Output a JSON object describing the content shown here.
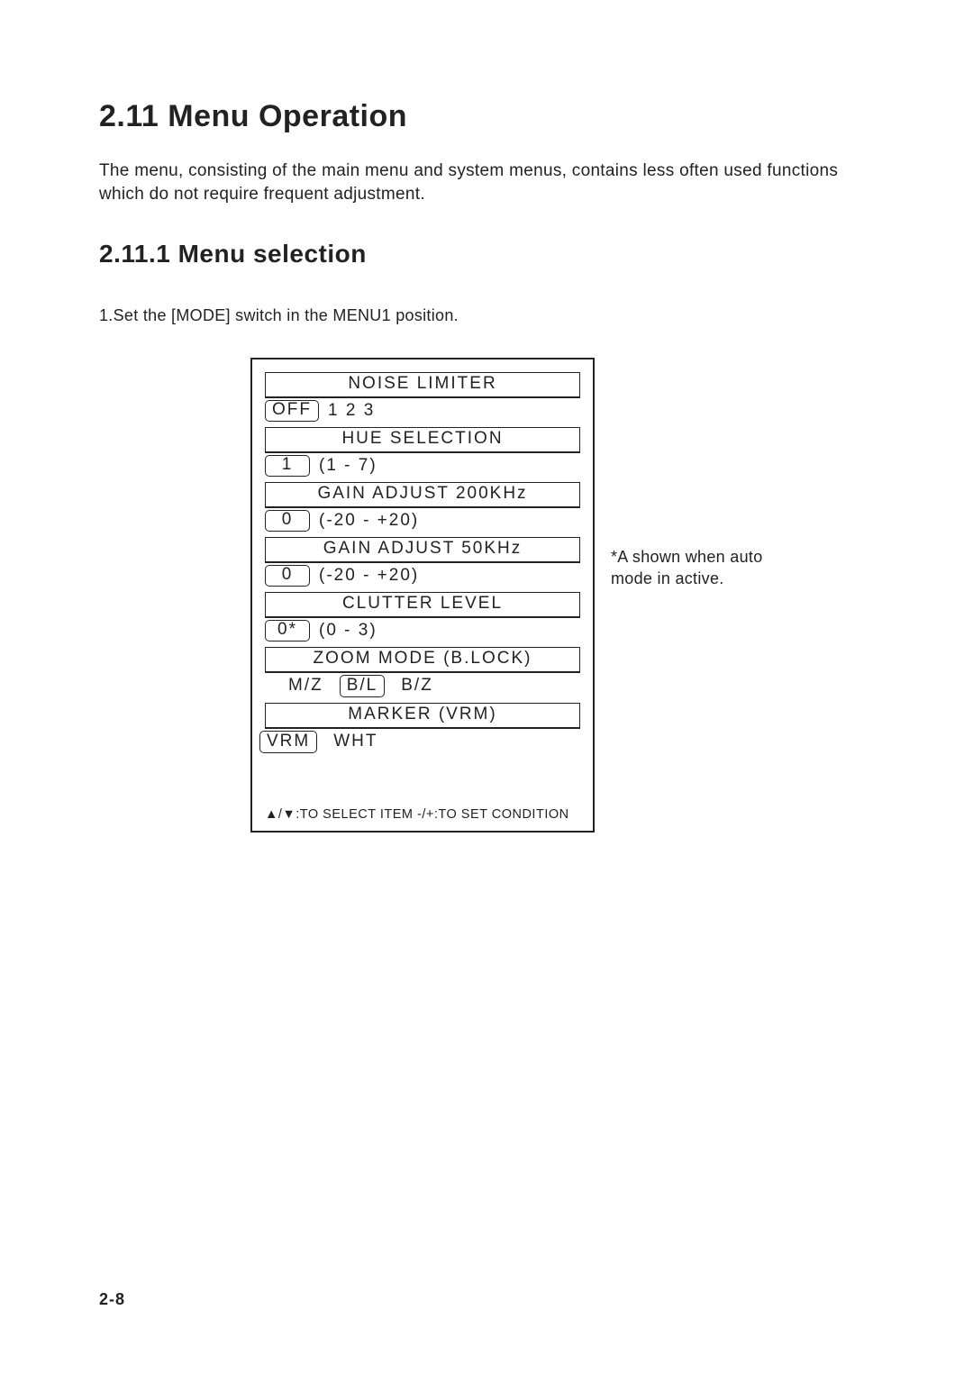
{
  "heading": "2.11  Menu Operation",
  "intro": "The menu, consisting of the main menu and system menus, contains less often used functions which do not require frequent adjustment.",
  "subheading": "2.11.1 Menu selection",
  "step1": "1.Set the [MODE] switch in the MENU1 position.",
  "menu": {
    "items": [
      {
        "title": "NOISE LIMITER",
        "selected": "OFF",
        "rest": "1  2  3"
      },
      {
        "title": "HUE SELECTION",
        "selected": "1",
        "rest": "(1 - 7)"
      },
      {
        "title": "GAIN ADJUST 200KHz",
        "selected": "0",
        "rest": "(-20 - +20)"
      },
      {
        "title": "GAIN ADJUST 50KHz",
        "selected": "0",
        "rest": "(-20 - +20)"
      },
      {
        "title": "CLUTTER LEVEL",
        "selected": "0*",
        "rest": "(0 - 3)"
      },
      {
        "title": "ZOOM MODE (B.LOCK)",
        "opts": [
          "M/Z",
          "B/L",
          "B/Z"
        ],
        "sel_index": 1
      },
      {
        "title": "MARKER (VRM)",
        "opts": [
          "VRM",
          "WHT"
        ],
        "sel_index": 0
      }
    ],
    "footer_pre": ":TO SELECT ITEM  -/+:TO SET CONDITION"
  },
  "sidenote": "*A shown when  auto mode in  active.",
  "page_number": "2-8"
}
